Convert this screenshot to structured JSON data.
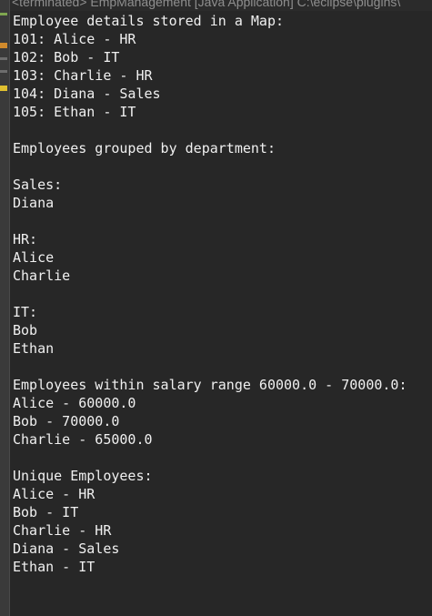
{
  "window": {
    "title": "<terminated> EmpManagement [Java Application] C:\\eclipse\\plugins\\"
  },
  "gutter": {
    "markers": [
      "green-marker",
      "orange-marker",
      "grey-marker",
      "grey-marker",
      "yellow-marker"
    ]
  },
  "console": {
    "lines": [
      "Employee details stored in a Map:",
      "101: Alice - HR",
      "102: Bob - IT",
      "103: Charlie - HR",
      "104: Diana - Sales",
      "105: Ethan - IT",
      "",
      "Employees grouped by department:",
      "",
      "Sales:",
      "Diana",
      "",
      "HR:",
      "Alice",
      "Charlie",
      "",
      "IT:",
      "Bob",
      "Ethan",
      "",
      "Employees within salary range 60000.0 - 70000.0:",
      "Alice - 60000.0",
      "Bob - 70000.0",
      "Charlie - 65000.0",
      "",
      "Unique Employees:",
      "Alice - HR",
      "Bob - IT",
      "Charlie - HR",
      "Diana - Sales",
      "Ethan - IT"
    ]
  }
}
